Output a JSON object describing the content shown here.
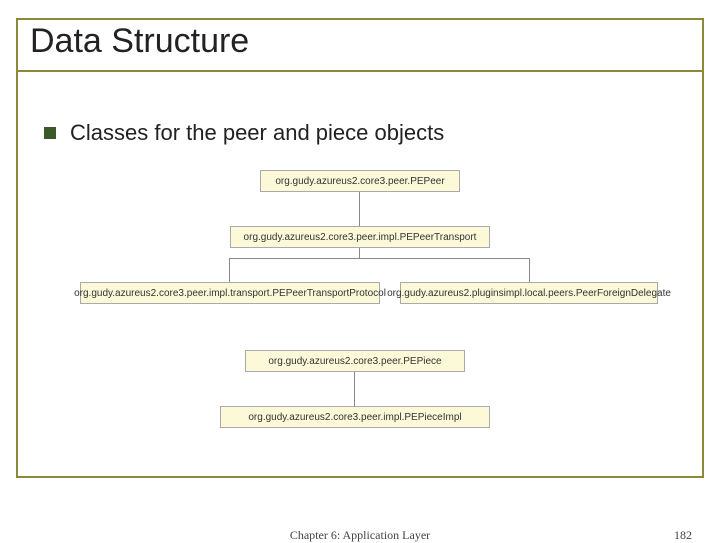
{
  "slide": {
    "title": "Data Structure",
    "bullet": "Classes for the peer and piece objects"
  },
  "diagram": {
    "nodes": {
      "pepeer": "org.gudy.azureus2.core3.peer.PEPeer",
      "pepeer_transport": "org.gudy.azureus2.core3.peer.impl.PEPeerTransport",
      "transport_protocol": "org.gudy.azureus2.core3.peer.impl.transport.PEPeerTransportProtocol",
      "foreign_delegate": "org.gudy.azureus2.pluginsimpl.local.peers.PeerForeignDelegate",
      "pepiece": "org.gudy.azureus2.core3.peer.PEPiece",
      "pepiece_impl": "org.gudy.azureus2.core3.peer.impl.PEPieceImpl"
    }
  },
  "footer": {
    "chapter": "Chapter 6: Application Layer",
    "page": "182"
  }
}
